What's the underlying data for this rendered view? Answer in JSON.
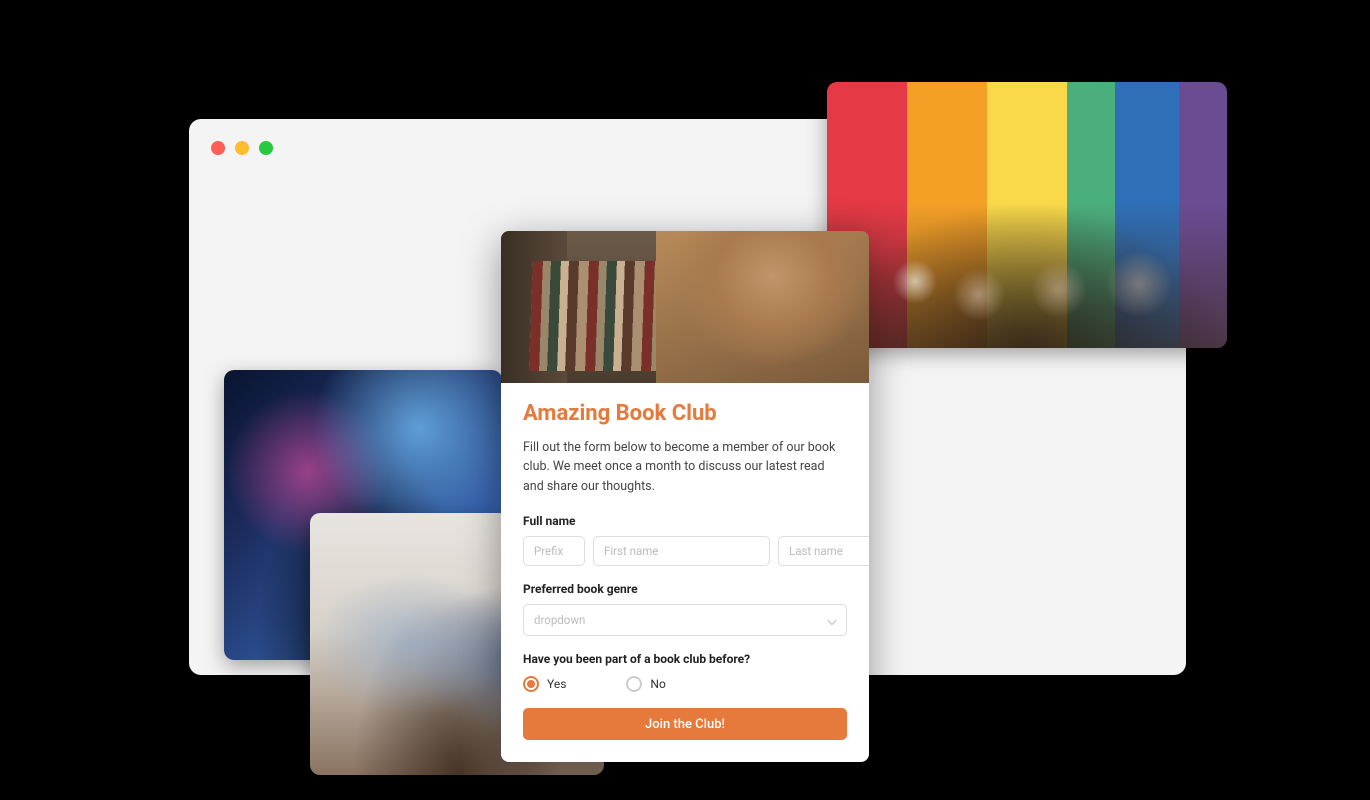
{
  "form": {
    "title": "Amazing Book Club",
    "description": "Fill out the form below to become a member of our book club. We meet once a month to discuss our latest read and share our thoughts.",
    "full_name_label": "Full name",
    "prefix_placeholder": "Prefix",
    "first_name_placeholder": "First name",
    "last_name_placeholder": "Last name",
    "genre_label": "Preferred book genre",
    "genre_placeholder": "dropdown",
    "prior_label": "Have you been part of a book club before?",
    "option_yes": "Yes",
    "option_no": "No",
    "selected_option": "yes",
    "submit_label": "Join the Club!"
  },
  "colors": {
    "accent": "#e67a3c"
  }
}
